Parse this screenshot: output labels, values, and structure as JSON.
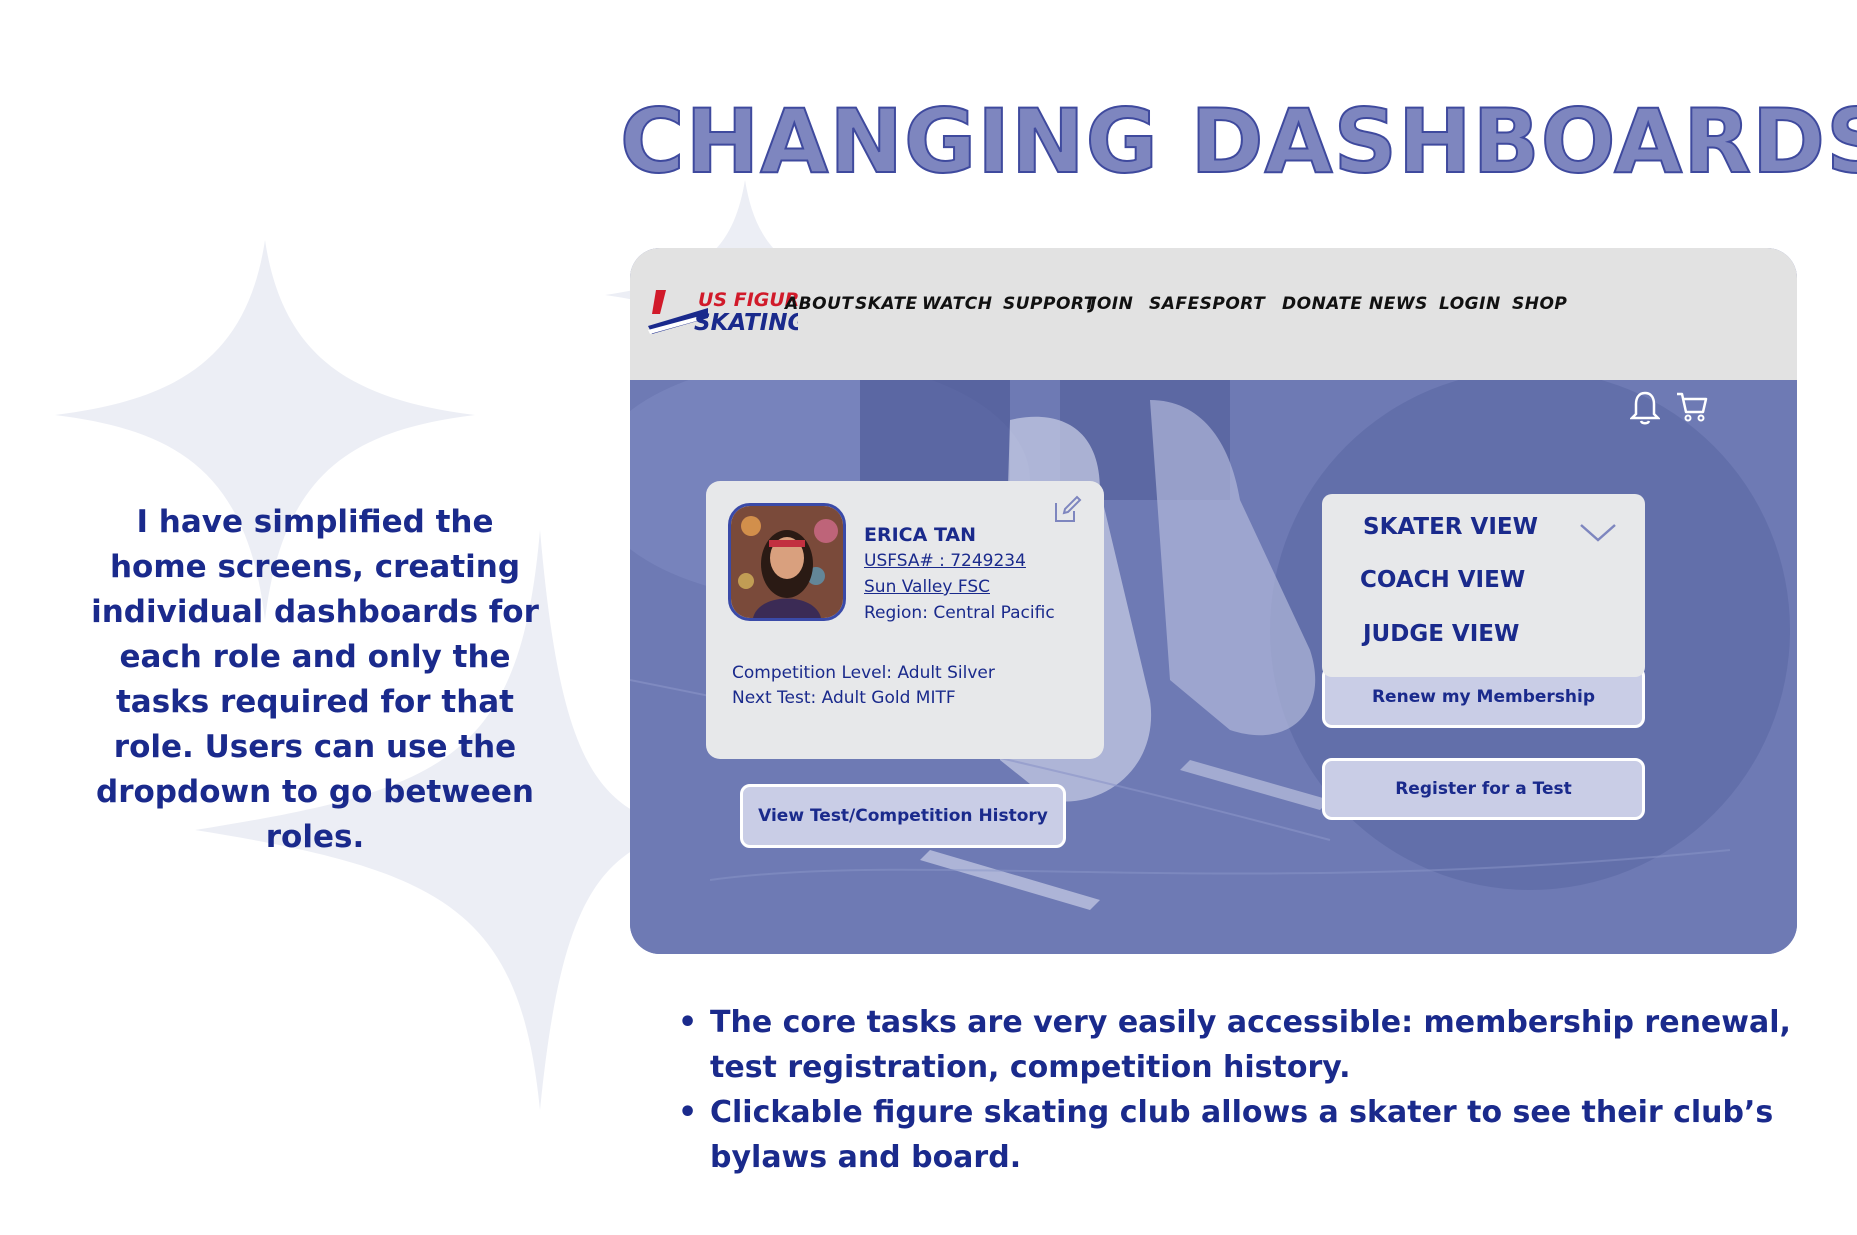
{
  "slide": {
    "title": "CHANGING DASHBOARDS",
    "intro": "I have simplified the home screens, creating individual dashboards for each role and only the tasks required for that role. Users can use the dropdown to go between roles.",
    "bullets": [
      "The core tasks are very easily accessible: membership renewal, test registration, competition history.",
      " Clickable figure skating club allows a skater to see their club’s bylaws and board."
    ]
  },
  "navbar": {
    "logo_line1": "US FIGURE",
    "logo_line2": "SKATING",
    "items": [
      "ABOUT",
      "SKATE",
      "WATCH",
      "SUPPORT",
      "JOIN",
      "SAFESPORT",
      "DONATE",
      "NEWS",
      "LOGIN",
      "SHOP"
    ]
  },
  "icons": {
    "bell": "bell-icon",
    "cart": "cart-icon",
    "edit": "edit-icon",
    "chevron": "chevron-down-icon"
  },
  "profile": {
    "name": "ERICA TAN",
    "usfsa": "USFSA# : 7249234",
    "club": "Sun Valley FSC",
    "region": "Region: Central Pacific",
    "competition_level": "Competition Level: Adult Silver",
    "next_test": "Next Test: Adult Gold MITF"
  },
  "roles": {
    "selected": "SKATER VIEW",
    "options": [
      "SKATER VIEW",
      "COACH VIEW",
      "JUDGE VIEW"
    ]
  },
  "actions": {
    "history": "View Test/Competition History",
    "renew": "Renew my Membership",
    "register": "Register for a Test"
  },
  "colors": {
    "accent": "#1a2a8c",
    "title_fill": "#7e86bf",
    "hero_overlay": "#6e7ab4",
    "navbar_bg": "#e2e2e2",
    "sparkle": "#eceef5",
    "logo_red": "#d11a2a"
  }
}
